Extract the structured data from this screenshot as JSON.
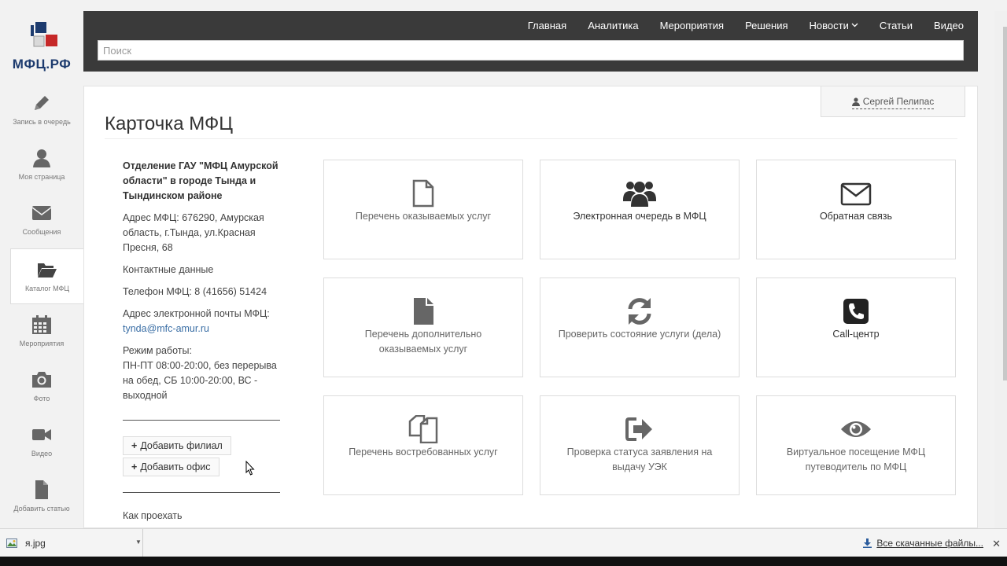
{
  "logo": {
    "text": "МФЦ.РФ"
  },
  "sidebar": {
    "items": [
      {
        "label": "Запись в очередь",
        "icon": "pencil-icon"
      },
      {
        "label": "Моя страница",
        "icon": "user-icon"
      },
      {
        "label": "Сообщения",
        "icon": "envelope-icon"
      },
      {
        "label": "Каталог МФЦ",
        "icon": "folder-open-icon",
        "active": true
      },
      {
        "label": "Мероприятия",
        "icon": "calendar-icon"
      },
      {
        "label": "Фото",
        "icon": "camera-icon"
      },
      {
        "label": "Видео",
        "icon": "video-camera-icon"
      },
      {
        "label": "Добавить статью",
        "icon": "file-icon"
      }
    ]
  },
  "nav": {
    "items": [
      "Главная",
      "Аналитика",
      "Мероприятия",
      "Решения",
      "Новости",
      "Статьи",
      "Видео"
    ]
  },
  "search": {
    "placeholder": "Поиск"
  },
  "user": {
    "name": "Сергей Пелипас"
  },
  "page": {
    "title": "Карточка МФЦ"
  },
  "info": {
    "org": "Отделение ГАУ \"МФЦ Амурской области\" в городе Тында и Тындинском районе",
    "address": "Адрес МФЦ: 676290, Амурская область, г.Тында, ул.Красная Пресня, 68",
    "contacts_heading": "Контактные данные",
    "phone": "Телефон МФЦ: 8 (41656) 51424",
    "email_label": "Адрес электронной почты МФЦ:",
    "email": "tynda@mfc-amur.ru",
    "hours_label": "Режим работы:",
    "hours": "ПН-ПТ 08:00-20:00, без перерыва на обед, СБ 10:00-20:00, ВС - выходной",
    "add_branch": "Добавить филиал",
    "add_office": "Добавить офис",
    "how_to_get": "Как проехать"
  },
  "tiles": [
    {
      "label": "Перечень оказываемых услуг",
      "icon": "file-outline-icon"
    },
    {
      "label": "Электронная очередь в МФЦ",
      "icon": "users-icon"
    },
    {
      "label": "Обратная связь",
      "icon": "envelope-outline-icon"
    },
    {
      "label": "Перечень дополнительно оказываемых услуг",
      "icon": "file-solid-icon"
    },
    {
      "label": "Проверить состояние услуги (дела)",
      "icon": "refresh-icon"
    },
    {
      "label": "Call-центр",
      "icon": "phone-square-icon"
    },
    {
      "label": "Перечень востребованных услуг",
      "icon": "files-icon"
    },
    {
      "label": "Проверка статуса заявления на выдачу УЭК",
      "icon": "sign-in-icon"
    },
    {
      "label": "Виртуальное посещение МФЦ путеводитель по МФЦ",
      "icon": "eye-icon"
    }
  ],
  "downloads": {
    "file": "я.jpg",
    "all_label": "Все скачанные файлы..."
  },
  "colors": {
    "topbar": "#3a3a3a",
    "logo": "#1d3b6e",
    "link": "#3a6ea5"
  }
}
